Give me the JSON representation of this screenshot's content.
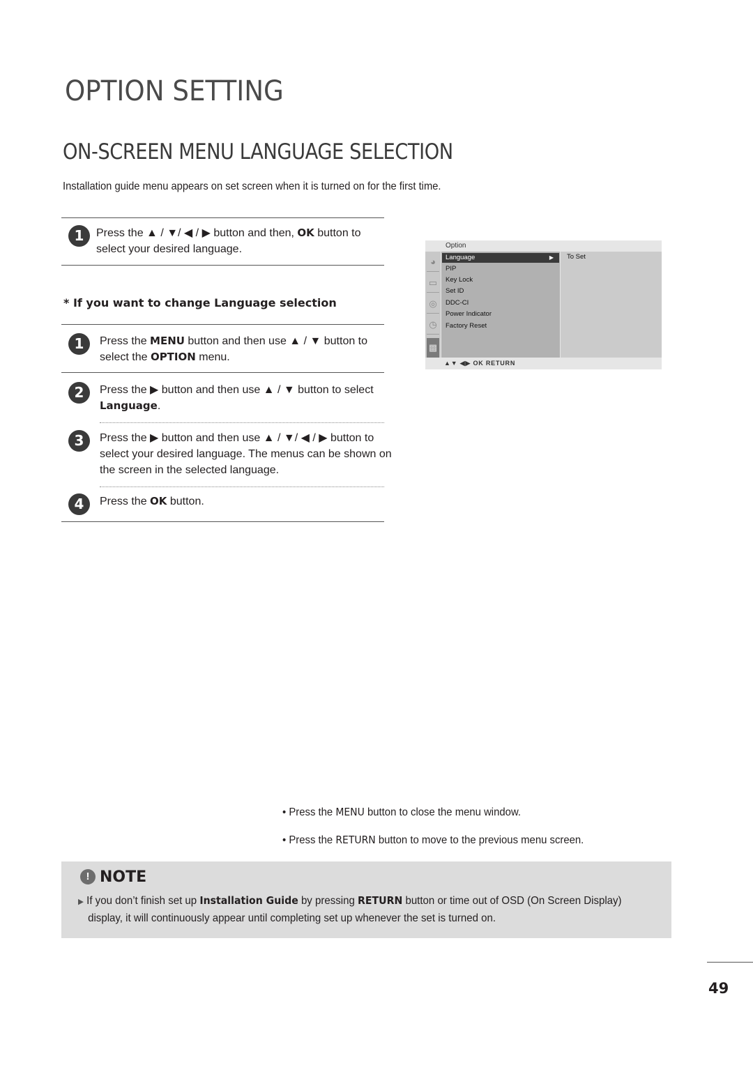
{
  "page": {
    "title": "OPTION SETTING",
    "section_title": "ON-SCREEN MENU LANGUAGE SELECTION",
    "intro": "Installation guide menu appears on set screen when it is turned on for the first time.",
    "page_number": "49"
  },
  "first_setup": {
    "step": {
      "number": "1",
      "text_before": "Press the ▲ / ▼/ ◀ / ▶ button and then, ",
      "key": "OK",
      "text_after": " button to select your desired language."
    }
  },
  "change_language": {
    "heading": "* If you want to change Language selection",
    "steps": [
      {
        "number": "1",
        "parts": [
          "Press the ",
          "MENU",
          " button and then use ▲ / ▼  button to select the ",
          "OPTION",
          " menu."
        ]
      },
      {
        "number": "2",
        "parts": [
          "Press the ▶ button and then use ▲ / ▼ button to select ",
          "Language",
          "."
        ]
      },
      {
        "number": "3",
        "parts": [
          "Press the ▶ button and then use ▲ / ▼/ ◀ / ▶ button to select your desired language.  The menus can be shown on the screen in the selected language."
        ]
      },
      {
        "number": "4",
        "parts": [
          "Press the ",
          "OK",
          " button."
        ]
      }
    ]
  },
  "osd_menu": {
    "header": "Option",
    "icons": [
      "option-icon",
      "screen-icon",
      "sound-icon",
      "time-icon",
      "special-icon"
    ],
    "items": [
      "Language",
      "PIP",
      "Key Lock",
      "Set ID",
      "DDC-CI",
      "Power Indicator",
      "Factory Reset"
    ],
    "selected_index": 0,
    "selected_arrow": "▶",
    "value": "To Set",
    "footer": "▲▼   ◀▶   OK   RETURN"
  },
  "bullets": [
    {
      "parts": [
        "• Press the ",
        "MENU",
        " button to close the menu window."
      ]
    },
    {
      "parts": [
        "• Press the ",
        "RETURN",
        " button to move to the previous menu screen."
      ]
    }
  ],
  "note": {
    "icon": "!",
    "title": "NOTE",
    "bullet": "▶",
    "parts": [
      "If you don’t finish set up ",
      "Installation Guide",
      " by pressing ",
      "RETURN",
      " button or time out of OSD (On Screen Display)"
    ],
    "continuation": "display, it will continuously appear until completing set up whenever the set is turned on."
  }
}
